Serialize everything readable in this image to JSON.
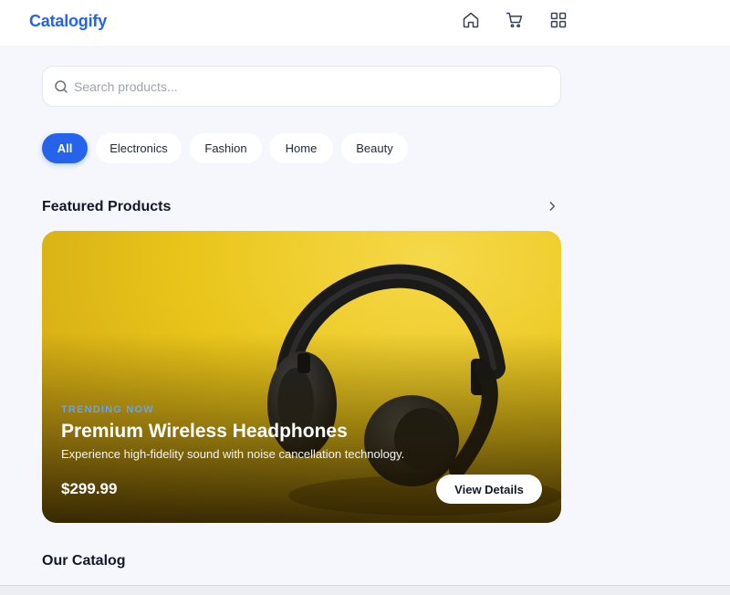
{
  "app": {
    "brand": "Catalogify"
  },
  "nav": {
    "icons": [
      "home-icon",
      "cart-icon",
      "grid-icon"
    ]
  },
  "search": {
    "placeholder": "Search products...",
    "value": ""
  },
  "categories": {
    "items": [
      "All",
      "Electronics",
      "Fashion",
      "Home",
      "Beauty"
    ],
    "active": "All"
  },
  "featured": {
    "section_title": "Featured Products",
    "tag": "TRENDING NOW",
    "title": "Premium Wireless Headphones",
    "description": "Experience high-fidelity sound with noise cancellation technology.",
    "price": "$299.99",
    "button_label": "View Details"
  },
  "catalog": {
    "section_title": "Our Catalog"
  },
  "colors": {
    "accent": "#2563eb",
    "tag": "#60a5fa",
    "hero_bg": "#e9c51a"
  }
}
